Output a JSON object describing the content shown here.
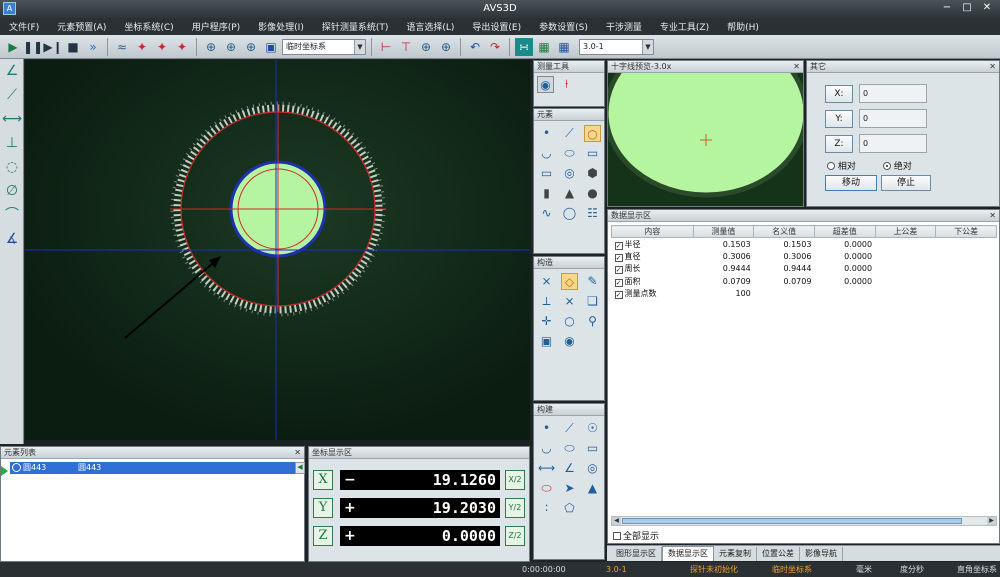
{
  "window": {
    "title": "AVS3D",
    "ctrl_min": "−",
    "ctrl_max": "□",
    "ctrl_close": "✕",
    "icon": "app-icon"
  },
  "menu": [
    "文件(F)",
    "元素预置(A)",
    "坐标系统(C)",
    "用户程序(P)",
    "影像处理(I)",
    "探针测量系统(T)",
    "语言选择(L)",
    "导出设置(E)",
    "参数设置(S)",
    "干涉测量",
    "专业工具(Z)",
    "帮助(H)"
  ],
  "toolbar": {
    "coord_select": "临时坐标系",
    "zoom_select": "3.0-1"
  },
  "measure_tools": {
    "title": "测量工具"
  },
  "elements_panel": {
    "title": "元素"
  },
  "construct_panel": {
    "title": "构造"
  },
  "relation_panel": {
    "title": "构建"
  },
  "crosshair_view": {
    "title": "十字线预览-3.0x"
  },
  "position_panel": {
    "title": "其它",
    "x_label": "X:",
    "y_label": "Y:",
    "z_label": "Z:",
    "x_value": "0",
    "y_value": "0",
    "z_value": "0",
    "relative_label": "相对",
    "absolute_label": "绝对",
    "move_label": "移动",
    "stop_label": "停止"
  },
  "data_panel": {
    "title": "数据显示区",
    "columns": [
      "内容",
      "测量值",
      "名义值",
      "超差值",
      "上公差",
      "下公差"
    ],
    "rows": [
      {
        "name": "半径",
        "measured": "0.1503",
        "nominal": "0.1503",
        "deviation": "0.0000"
      },
      {
        "name": "直径",
        "measured": "0.3006",
        "nominal": "0.3006",
        "deviation": "0.0000"
      },
      {
        "name": "周长",
        "measured": "0.9444",
        "nominal": "0.9444",
        "deviation": "0.0000"
      },
      {
        "name": "面积",
        "measured": "0.0709",
        "nominal": "0.0709",
        "deviation": "0.0000"
      },
      {
        "name": "测量点数",
        "measured": "100",
        "nominal": "",
        "deviation": ""
      }
    ],
    "show_all_label": "全部显示"
  },
  "bottom_tabs": [
    "图形显示区",
    "数据显示区",
    "元素复制",
    "位置公差",
    "影像导航"
  ],
  "element_list": {
    "title": "元素列表",
    "item_id": "圆443",
    "item_name": "圆443"
  },
  "coord_display": {
    "title": "坐标显示区",
    "x": {
      "axis": "X",
      "sign": "−",
      "value": "19.1260",
      "half": "X/2"
    },
    "y": {
      "axis": "Y",
      "sign": "+",
      "value": "19.2030",
      "half": "Y/2"
    },
    "z": {
      "axis": "Z",
      "sign": "+",
      "value": "0.0000",
      "half": "Z/2"
    }
  },
  "status": {
    "time": "0:00:00:00",
    "zoom": "3.0-1",
    "probe": "探针未初始化",
    "coord": "临时坐标系",
    "unit": "毫米",
    "angle": "度分秒",
    "coord_type": "直角坐标系"
  },
  "colors": {
    "accent_green": "#1b7a3c",
    "selection_blue": "#2f6fd6",
    "status_orange": "#f0a030",
    "measure_fill": "#b6f5a0",
    "measure_circle": "#d02a2a"
  }
}
